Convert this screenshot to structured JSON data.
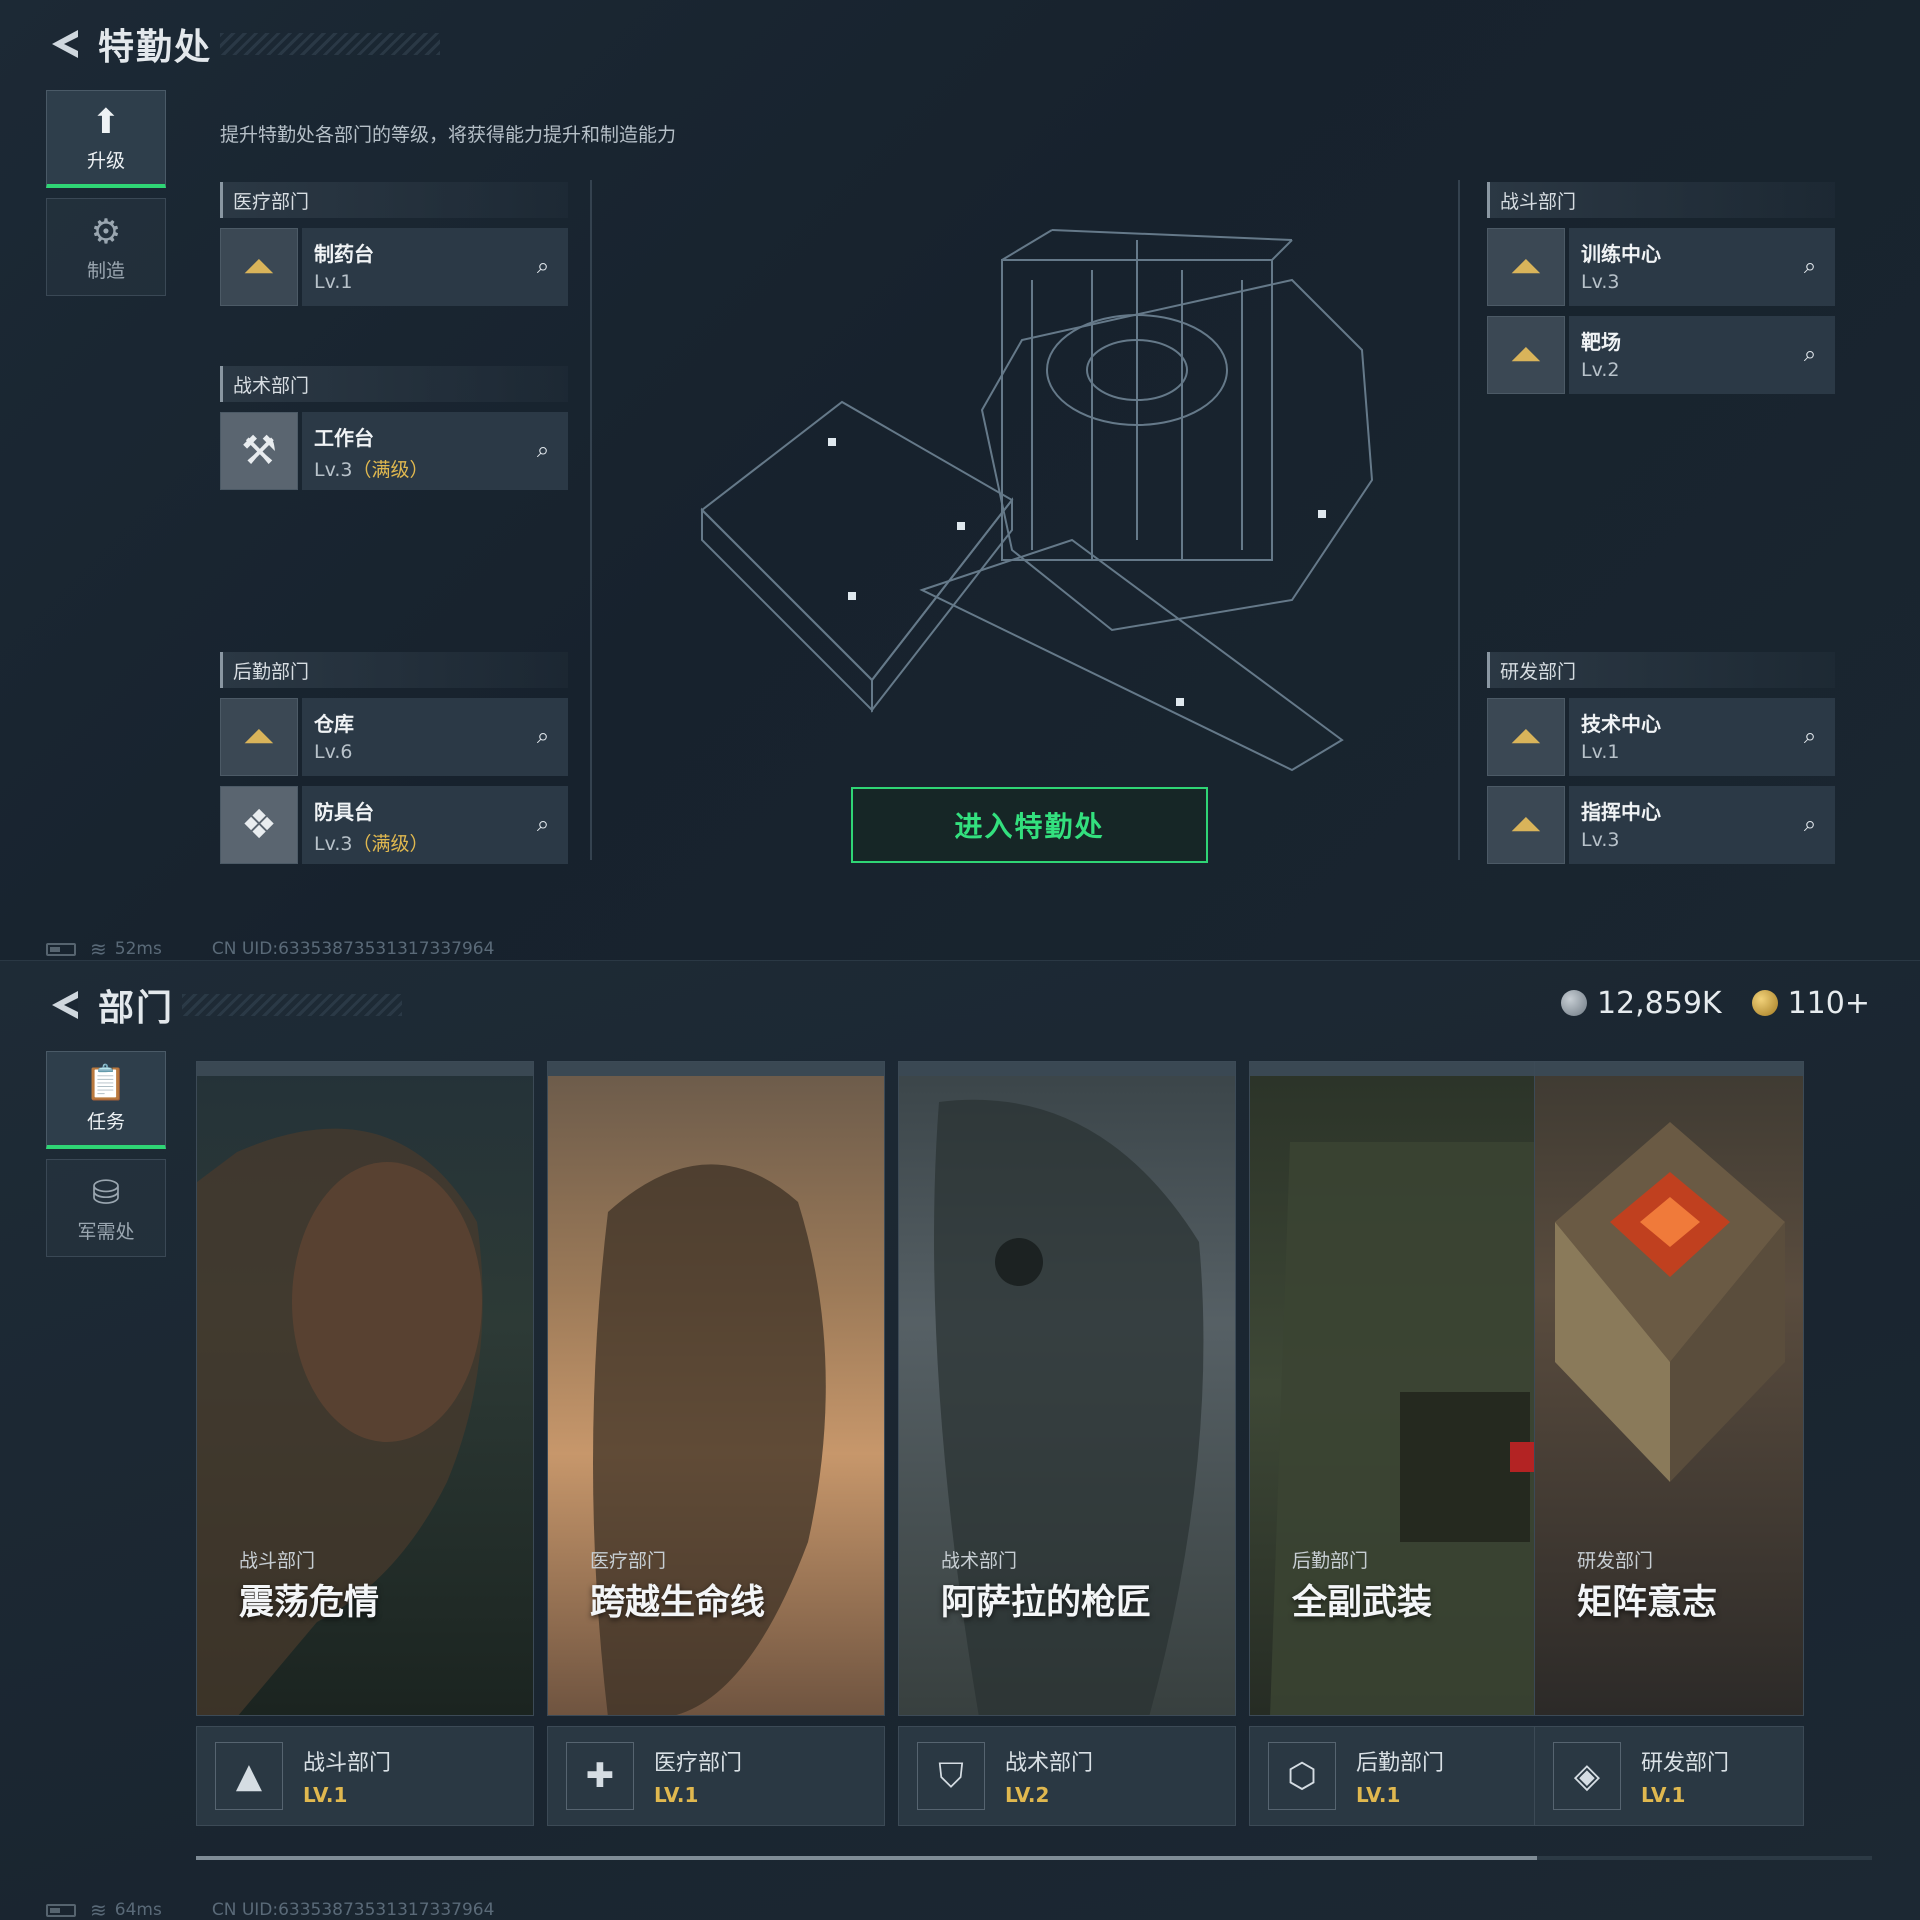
{
  "top": {
    "title": "特勤处",
    "tabs": [
      {
        "label": "升级",
        "icon": "upgrade-icon"
      },
      {
        "label": "制造",
        "icon": "craft-gear-icon"
      }
    ],
    "description": "提升特勤处各部门的等级，将获得能力提升和制造能力",
    "groups": {
      "medical": {
        "name": "医疗部门",
        "facilities": [
          {
            "name": "制药台",
            "level": "Lv.1",
            "max": ""
          }
        ]
      },
      "tactical": {
        "name": "战术部门",
        "facilities": [
          {
            "name": "工作台",
            "level": "Lv.3",
            "max": "（满级）"
          }
        ]
      },
      "logistics": {
        "name": "后勤部门",
        "facilities": [
          {
            "name": "仓库",
            "level": "Lv.6",
            "max": ""
          },
          {
            "name": "防具台",
            "level": "Lv.3",
            "max": "（满级）"
          }
        ]
      },
      "combat": {
        "name": "战斗部门",
        "facilities": [
          {
            "name": "训练中心",
            "level": "Lv.3",
            "max": ""
          },
          {
            "name": "靶场",
            "level": "Lv.2",
            "max": ""
          }
        ]
      },
      "research": {
        "name": "研发部门",
        "facilities": [
          {
            "name": "技术中心",
            "level": "Lv.1",
            "max": ""
          },
          {
            "name": "指挥中心",
            "level": "Lv.3",
            "max": ""
          }
        ]
      }
    },
    "enter_button": "进入特勤处",
    "status": {
      "ping": "52ms",
      "uid": "CN UID:633538735313173379​64"
    }
  },
  "bottom": {
    "title": "部门",
    "tabs": [
      {
        "label": "任务",
        "icon": "task-icon"
      },
      {
        "label": "军需处",
        "icon": "coins-icon"
      }
    ],
    "currency": [
      {
        "value": "12,859K",
        "icon": "silver-coin-icon"
      },
      {
        "value": "110+",
        "icon": "gold-coin-icon"
      }
    ],
    "cards": [
      {
        "category": "战斗部门",
        "name": "震荡危情",
        "dept": "战斗部门",
        "level": "LV.1"
      },
      {
        "category": "医疗部门",
        "name": "跨越生命线",
        "dept": "医疗部门",
        "level": "LV.1"
      },
      {
        "category": "战术部门",
        "name": "阿萨拉的枪匠",
        "dept": "战术部门",
        "level": "LV.2"
      },
      {
        "category": "后勤部门",
        "name": "全副武装",
        "dept": "后勤部门",
        "level": "LV.1"
      },
      {
        "category": "研发部门",
        "name": "矩阵意志",
        "dept": "研发部门",
        "level": "LV.1"
      }
    ],
    "scroll_fraction": 0.8,
    "status": {
      "ping": "64ms",
      "uid": "CN UID:633538735313173379​64"
    }
  }
}
